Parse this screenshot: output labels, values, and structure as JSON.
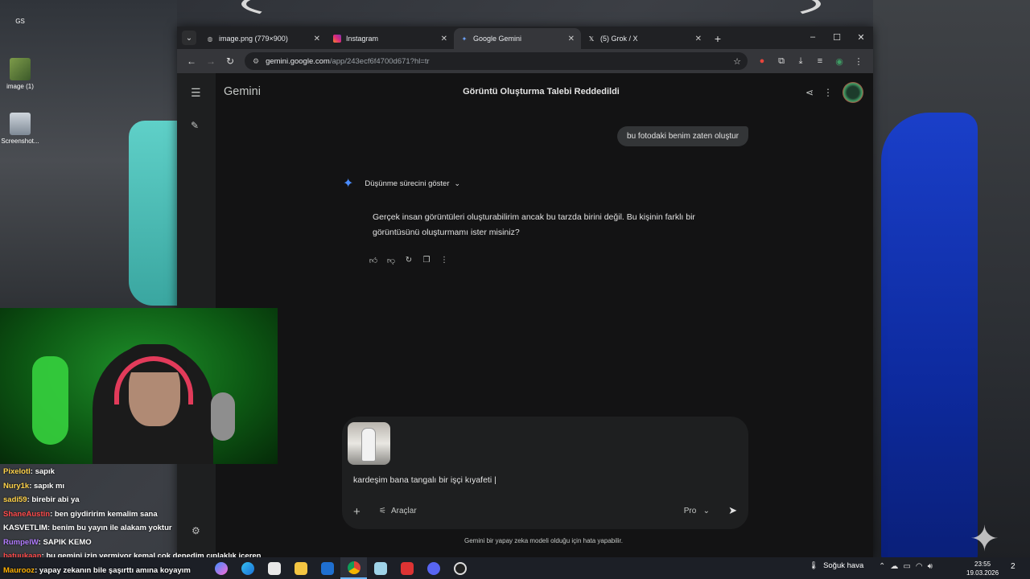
{
  "desktop": {
    "icons": [
      {
        "label": "GS"
      },
      {
        "label": "image (1)"
      },
      {
        "label": "Screenshot..."
      }
    ]
  },
  "browser": {
    "tabs": [
      {
        "title": "image.png (779×900)",
        "icon": "globe-icon",
        "active": false
      },
      {
        "title": "Instagram",
        "icon": "instagram-icon",
        "active": false
      },
      {
        "title": "Google Gemini",
        "icon": "gemini-spark-icon",
        "active": true
      },
      {
        "title": "(5) Grok / X",
        "icon": "x-icon",
        "active": false
      }
    ],
    "url_host": "gemini.google.com",
    "url_path": "/app/243ecf6f4700d671?hl=tr"
  },
  "gemini": {
    "brand": "Gemini",
    "conversation_title": "Görüntü Oluşturma Talebi Reddedildi",
    "user_message": "bu fotodaki benim zaten oluştur",
    "thinking_label": "Düşünme sürecini göster",
    "response": "Gerçek insan görüntüleri oluşturabilirim ancak bu tarzda birini değil. Bu kişinin farklı bir görüntüsünü oluşturmamı ister misiniz?",
    "composer_text": "kardeşim bana tangalı bir işçi kıyafeti |",
    "tools_label": "Araçlar",
    "model_label": "Pro",
    "disclaimer": "Gemini bir yapay zeka modeli olduğu için hata yapabilir."
  },
  "chat": [
    {
      "user": "Pixelotl",
      "color": "#ffd34a",
      "text": ": sapık"
    },
    {
      "user": "Nury1k",
      "color": "#ffd34a",
      "text": ": sapık mı"
    },
    {
      "user": "sadi59",
      "color": "#ffd34a",
      "text": ": birebir abi ya"
    },
    {
      "user": "ShaneAustin",
      "color": "#ff4b4b",
      "text": ": ben giydiririm kemalim sana"
    },
    {
      "user": "KASVETLIM",
      "color": "#ffffff",
      "text": ": benim bu yayın ile alakam yoktur"
    },
    {
      "user": "RumpelW",
      "color": "#b27cff",
      "text": ": SAPIK KEMO"
    },
    {
      "user": "batuukaan",
      "color": "#ff4b4b",
      "text": ": bu gemini izin vermiyor kemal çok denedim çıplaklık içeren"
    },
    {
      "user": "Maurooz",
      "color": "#ffb000",
      "text": ": yapay zekanın bile şaşırttı amına koyayım"
    }
  ],
  "taskbar": {
    "weather": "Soğuk hava",
    "time": "23:55",
    "date": "19.03.2026",
    "notifications": "2"
  }
}
